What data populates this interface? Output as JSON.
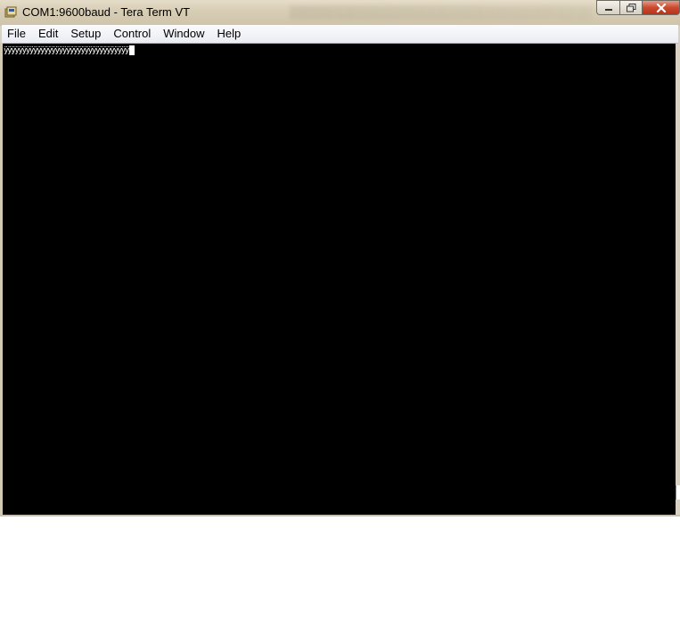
{
  "window": {
    "title": "COM1:9600baud - Tera Term VT",
    "app_icon": "tera-term-icon",
    "caption_buttons": {
      "minimize_icon": "minimize-icon",
      "maximize_icon": "maximize-icon",
      "close_icon": "close-icon"
    }
  },
  "menubar": {
    "items": [
      "File",
      "Edit",
      "Setup",
      "Control",
      "Window",
      "Help"
    ]
  },
  "terminal": {
    "background": "#000000",
    "foreground": "#ffffff",
    "line1": "ÿÿÿÿÿÿÿÿÿÿÿÿÿÿÿÿÿÿÿÿÿÿÿÿÿÿÿÿÿÿÿÿÿÿ"
  }
}
